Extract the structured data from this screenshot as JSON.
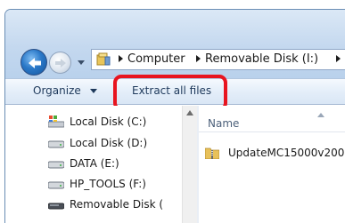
{
  "navigation": {
    "back_icon": "back-arrow-icon",
    "forward_icon": "forward-arrow-icon",
    "recent_pages_icon": "chevron-down-icon"
  },
  "address_bar": {
    "location_icon": "removable-drive-icon",
    "breadcrumbs": [
      {
        "label": "Computer"
      },
      {
        "label": "Removable Disk (I:)"
      }
    ]
  },
  "toolbar": {
    "organize_label": "Organize",
    "extract_all_label": "Extract all files",
    "highlight_color": "#e8141f"
  },
  "nav_pane": {
    "drives": [
      {
        "label": "Local Disk (C:)",
        "icon": "system-drive-icon"
      },
      {
        "label": "Local Disk (D:)",
        "icon": "hard-drive-icon"
      },
      {
        "label": "DATA (E:)",
        "icon": "hard-drive-icon"
      },
      {
        "label": "HP_TOOLS (F:)",
        "icon": "hard-drive-icon"
      },
      {
        "label": "Removable Disk (",
        "icon": "removable-drive-icon"
      }
    ]
  },
  "file_list": {
    "column_name": "Name",
    "items": [
      {
        "name": "UpdateMC15000v200",
        "icon": "compressed-folder-icon"
      }
    ]
  }
}
